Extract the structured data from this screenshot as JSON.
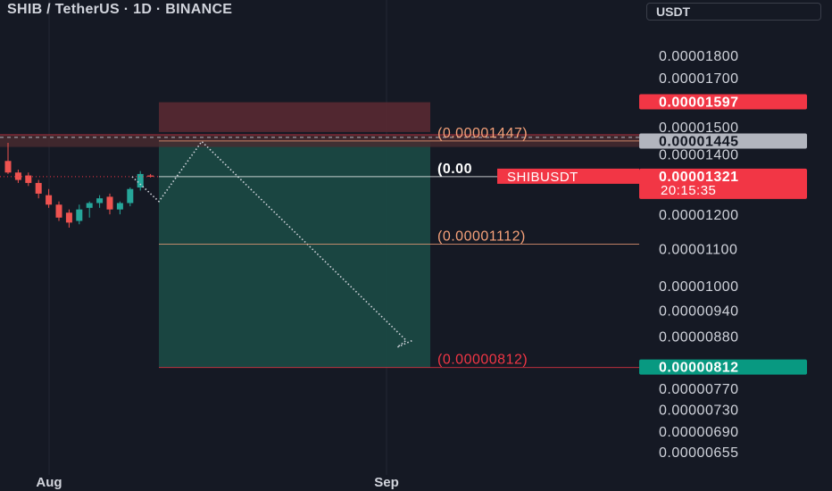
{
  "header": {
    "symbol_title": "SHIB / TetherUS · 1D · BINANCE",
    "currency": "USDT"
  },
  "colors": {
    "background": "#151924",
    "up": "#26a69a",
    "down": "#ef5350",
    "profit_zone": "#1b4a45",
    "loss_zone": "#5c2a33",
    "target_label": "#f23645",
    "entry_label": "#f7a27a"
  },
  "chart_data": {
    "type": "candlestick",
    "symbol_tag": "SHIBUSDT",
    "countdown": "20:15:35",
    "x_tick_labels": [
      {
        "label": "Aug"
      },
      {
        "label": "Sep"
      }
    ],
    "y_ticks": [
      1.8e-05,
      1.7e-05,
      1.5e-05,
      1.4e-05,
      1.2e-05,
      1.1e-05,
      1e-05,
      9.4e-06,
      8.8e-06,
      7.7e-06,
      7.3e-06,
      6.9e-06,
      6.55e-06
    ],
    "y_tick_labels": [
      "0.00001800",
      "0.00001700",
      "0.00001500",
      "0.00001400",
      "0.00001200",
      "0.00001100",
      "0.00001000",
      "0.00000940",
      "0.00000880",
      "0.00000770",
      "0.00000730",
      "0.00000690",
      "0.00000655"
    ],
    "candles": [
      {
        "open": 1.375e-05,
        "high": 1.44e-05,
        "low": 1.33e-05,
        "close": 1.335e-05
      },
      {
        "open": 1.335e-05,
        "high": 1.345e-05,
        "low": 1.3e-05,
        "close": 1.31e-05
      },
      {
        "open": 1.325e-05,
        "high": 1.335e-05,
        "low": 1.29e-05,
        "close": 1.3e-05
      },
      {
        "open": 1.3e-05,
        "high": 1.31e-05,
        "low": 1.25e-05,
        "close": 1.265e-05
      },
      {
        "open": 1.26e-05,
        "high": 1.28e-05,
        "low": 1.22e-05,
        "close": 1.23e-05
      },
      {
        "open": 1.23e-05,
        "high": 1.24e-05,
        "low": 1.18e-05,
        "close": 1.19e-05
      },
      {
        "open": 1.205e-05,
        "high": 1.215e-05,
        "low": 1.16e-05,
        "close": 1.175e-05
      },
      {
        "open": 1.18e-05,
        "high": 1.23e-05,
        "low": 1.17e-05,
        "close": 1.215e-05
      },
      {
        "open": 1.22e-05,
        "high": 1.24e-05,
        "low": 1.19e-05,
        "close": 1.235e-05
      },
      {
        "open": 1.235e-05,
        "high": 1.26e-05,
        "low": 1.22e-05,
        "close": 1.25e-05
      },
      {
        "open": 1.255e-05,
        "high": 1.265e-05,
        "low": 1.2e-05,
        "close": 1.215e-05
      },
      {
        "open": 1.215e-05,
        "high": 1.24e-05,
        "low": 1.2e-05,
        "close": 1.235e-05
      },
      {
        "open": 1.235e-05,
        "high": 1.285e-05,
        "low": 1.225e-05,
        "close": 1.28e-05
      },
      {
        "open": 1.285e-05,
        "high": 1.34e-05,
        "low": 1.275e-05,
        "close": 1.33e-05
      },
      {
        "open": 1.325e-05,
        "high": 1.33e-05,
        "low": 1.318e-05,
        "close": 1.321e-05
      }
    ],
    "price_markers": [
      {
        "text": "0.00001597",
        "value": 1.597e-05,
        "bg": "#f23645",
        "fg": "#ffffff"
      },
      {
        "text": "0.00001445",
        "value": 1.445e-05,
        "bg": "#b2b5be",
        "fg": "#131722"
      },
      {
        "text": "0.00001321",
        "value": 1.321e-05,
        "bg": "#f23645",
        "fg": "#ffffff"
      },
      {
        "text": "0.00000812",
        "value": 8.12e-06,
        "bg": "#089981",
        "fg": "#ffffff"
      }
    ],
    "position_tool": {
      "entry": 1.321e-05,
      "stop": 1.597e-05,
      "target": 8.12e-06
    },
    "levels": [
      {
        "label": "(0.00001447)",
        "value": 1.447e-05,
        "color": "#f7a27a"
      },
      {
        "label": "(0.00",
        "value": 1.321e-05,
        "color": "#ffffff"
      },
      {
        "label": "(0.00001112)",
        "value": 1.112e-05,
        "color": "#f7a27a"
      },
      {
        "label": "(0.00000812)",
        "value": 8.12e-06,
        "color": "#f23645"
      }
    ],
    "projection": [
      1.321e-05,
      1.24e-05,
      1.445e-05,
      8.7e-06,
      8.55e-06,
      8.7e-06
    ],
    "resistance_band": {
      "from": 1.425e-05,
      "to": 1.47e-05
    }
  }
}
